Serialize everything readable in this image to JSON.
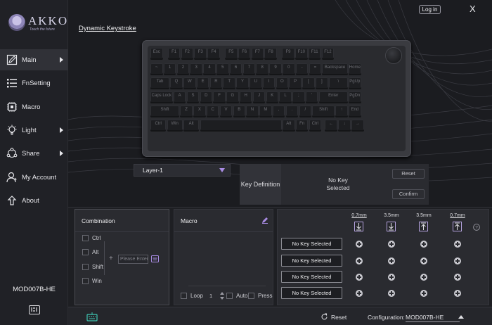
{
  "app": {
    "brand": "AKKO",
    "tagline": "Touch the future"
  },
  "header": {
    "title": "Dynamic Keystroke",
    "login_label": "Log in",
    "close_label": "X"
  },
  "sidebar": {
    "items": [
      {
        "label": "Main",
        "icon": "pencil-icon",
        "arrow": true,
        "active": true
      },
      {
        "label": "FnSetting",
        "icon": "list-icon",
        "arrow": false
      },
      {
        "label": "Macro",
        "icon": "chip-icon",
        "arrow": false
      },
      {
        "label": "Light",
        "icon": "bulb-icon",
        "arrow": true
      },
      {
        "label": "Share",
        "icon": "share-icon",
        "arrow": true
      },
      {
        "label": "My Account",
        "icon": "user-icon",
        "arrow": false
      },
      {
        "label": "About",
        "icon": "info-icon",
        "arrow": false
      }
    ],
    "device_name": "MOD007B-HE"
  },
  "keyboard": {
    "rows": [
      [
        "Esc",
        "F1",
        "F2",
        "F3",
        "F4",
        "F5",
        "F6",
        "F7",
        "F8",
        "F9",
        "F10",
        "F11",
        "F12"
      ],
      [
        "~",
        "1",
        "2",
        "3",
        "4",
        "5",
        "6",
        "7",
        "8",
        "9",
        "0",
        "-",
        "=",
        "Backspace",
        "Home"
      ],
      [
        "Tab",
        "Q",
        "W",
        "E",
        "R",
        "T",
        "Y",
        "U",
        "I",
        "O",
        "P",
        "[",
        "]",
        "\\",
        "PgUp"
      ],
      [
        "Caps Lock",
        "A",
        "S",
        "D",
        "F",
        "G",
        "H",
        "J",
        "K",
        "L",
        ";",
        "'",
        "Enter",
        "PgDn"
      ],
      [
        "Shift",
        "Z",
        "X",
        "C",
        "V",
        "B",
        "N",
        "M",
        ",",
        ".",
        "/",
        "Shift",
        "↑",
        "End"
      ],
      [
        "Ctrl",
        "Win",
        "Alt",
        "",
        "Alt",
        "Fn",
        "Ctrl",
        "←",
        "↓",
        "→"
      ]
    ]
  },
  "layer": {
    "selected": "Layer-1"
  },
  "key_definition": {
    "label": "Key Definition",
    "value_line1": "No Key",
    "value_line2": "Selected",
    "reset_label": "Reset",
    "confirm_label": "Confirm"
  },
  "combination": {
    "title": "Combination",
    "modifiers": [
      "Ctrl",
      "Alt",
      "Shift",
      "Win"
    ],
    "plus": "+",
    "input_placeholder": "Please Enter"
  },
  "macro": {
    "title": "Macro",
    "loop_label": "Loop",
    "loop_count": "1",
    "auto_label": "Auto",
    "press_label": "Press"
  },
  "travel": {
    "headers": [
      "0.7mm",
      "3.5mm",
      "3.5mm",
      "0.7mm"
    ],
    "slots": [
      "No Key Selected",
      "No Key Selected",
      "No Key Selected",
      "No Key Selected"
    ],
    "help": "?"
  },
  "footer": {
    "reset_label": "Reset",
    "config_label": "Configuration:",
    "config_value": "MOD007B-HE"
  },
  "colors": {
    "accent": "#a98ce4",
    "teal": "#3ec8b4"
  }
}
